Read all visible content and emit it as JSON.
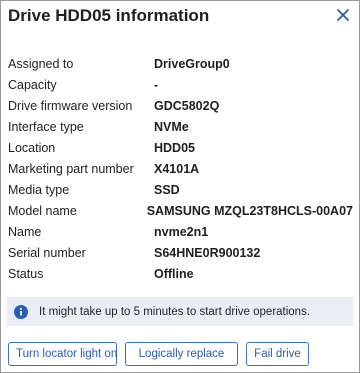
{
  "dialog": {
    "title": "Drive HDD05 information",
    "close_icon": "close-icon"
  },
  "properties": [
    {
      "label": "Assigned to",
      "value": "DriveGroup0"
    },
    {
      "label": "Capacity",
      "value": "-"
    },
    {
      "label": "Drive firmware version",
      "value": "GDC5802Q"
    },
    {
      "label": "Interface type",
      "value": "NVMe"
    },
    {
      "label": "Location",
      "value": "HDD05"
    },
    {
      "label": "Marketing part number",
      "value": "X4101A"
    },
    {
      "label": "Media type",
      "value": "SSD"
    },
    {
      "label": "Model name",
      "value": "SAMSUNG MZQL23T8HCLS-00A07"
    },
    {
      "label": "Name",
      "value": "nvme2n1"
    },
    {
      "label": "Serial number",
      "value": "S64HNE0R900132"
    },
    {
      "label": "Status",
      "value": "Offline"
    }
  ],
  "notice": {
    "icon": "info-icon",
    "text": "It might take up to 5 minutes to start drive operations."
  },
  "actions": {
    "locator_label": "Turn locator light on",
    "replace_label": "Logically replace",
    "fail_label": "Fail drive"
  },
  "colors": {
    "accent": "#2a5cb4",
    "notice_bg": "#e8eef8"
  }
}
